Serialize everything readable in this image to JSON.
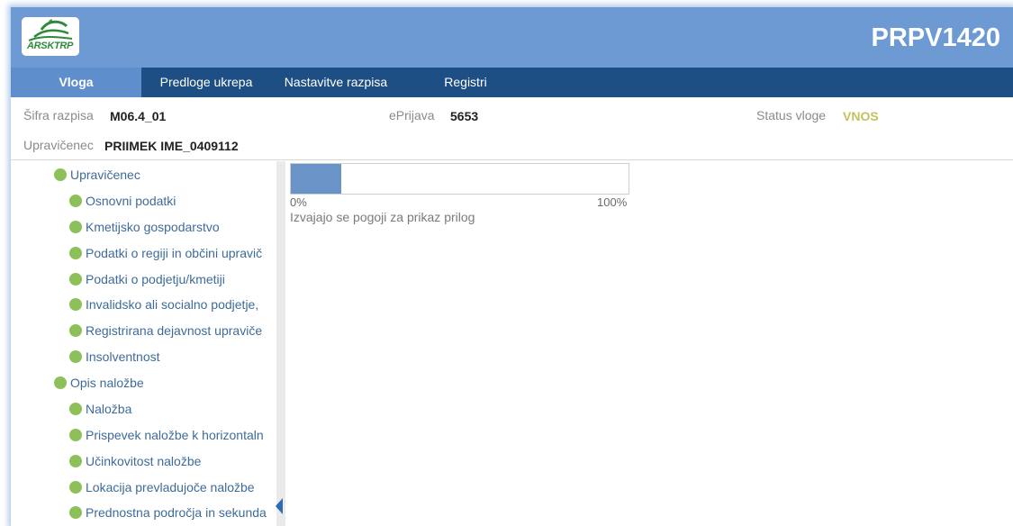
{
  "header": {
    "logo_text": "ARSKTRP",
    "app_code": "PRPV1420"
  },
  "nav": {
    "items": [
      {
        "label": "Vloga",
        "active": true
      },
      {
        "label": "Predloge ukrepa",
        "active": false
      },
      {
        "label": "Nastavitve razpisa",
        "active": false
      },
      {
        "label": "Registri",
        "active": false
      }
    ]
  },
  "info": {
    "sifra_label": "Šifra razpisa",
    "sifra_value": "M06.4_01",
    "eprijava_label": "ePrijava",
    "eprijava_value": "5653",
    "status_label": "Status vloge",
    "status_value": "VNOS",
    "upravicenec_label": "Upravičenec",
    "upravicenec_value": "PRIIMEK IME_0409112"
  },
  "tree": {
    "items": [
      {
        "label": "Upravičenec",
        "level": 0
      },
      {
        "label": "Osnovni podatki",
        "level": 1
      },
      {
        "label": "Kmetijsko gospodarstvo",
        "level": 1
      },
      {
        "label": "Podatki o regiji in občini upravič",
        "level": 1
      },
      {
        "label": "Podatki o podjetju/kmetiji",
        "level": 1
      },
      {
        "label": "Invalidsko ali socialno podjetje,",
        "level": 1
      },
      {
        "label": "Registrirana dejavnost upraviče",
        "level": 1
      },
      {
        "label": "Insolventnost",
        "level": 1
      },
      {
        "label": "Opis naložbe",
        "level": 0
      },
      {
        "label": "Naložba",
        "level": 1
      },
      {
        "label": "Prispevek naložbe k horizontaln",
        "level": 1
      },
      {
        "label": "Učinkovitost naložbe",
        "level": 1
      },
      {
        "label": "Lokacija prevladujoče naložbe",
        "level": 1
      },
      {
        "label": "Prednostna področja in sekunda",
        "level": 1
      }
    ]
  },
  "progress": {
    "fraction": 0.15,
    "min_label": "0%",
    "max_label": "100%",
    "message": "Izvajajo se pogoji za prikaz prilog"
  },
  "colors": {
    "header_bg": "#6d9ad2",
    "nav_bg": "#1e4f84",
    "nav_active_bg": "#5e8fcc",
    "status_color": "#c3c35a",
    "tree_dot": "#8ec05a",
    "tree_text": "#3e6b9a"
  }
}
